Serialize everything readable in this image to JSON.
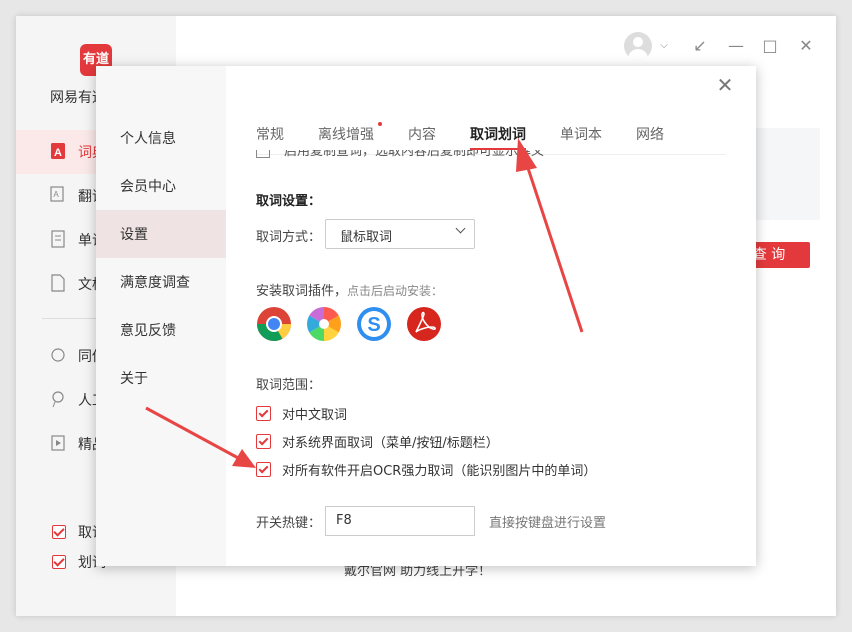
{
  "app": {
    "logo_text": "有道",
    "name": "网易有道",
    "sidebar": [
      {
        "label": "词典",
        "icon": "dictionary-icon"
      },
      {
        "label": "翻译",
        "icon": "translate-icon"
      },
      {
        "label": "单词本",
        "icon": "wordbook-icon"
      },
      {
        "label": "文档翻译",
        "icon": "document-icon"
      },
      {
        "label": "同传",
        "icon": "interpretation-icon"
      },
      {
        "label": "人工翻译",
        "icon": "human-translation-icon"
      },
      {
        "label": "精品课",
        "icon": "course-icon"
      }
    ],
    "bottom_checks": [
      {
        "label": "取词",
        "checked": true
      },
      {
        "label": "划词",
        "checked": true
      }
    ],
    "query_button": "查 询",
    "bottom_text": "戴尔官网 助力线上开学！"
  },
  "dialog": {
    "nav": [
      "个人信息",
      "会员中心",
      "设置",
      "满意度调查",
      "意见反馈",
      "关于"
    ],
    "active_nav": "设置",
    "tabs": [
      "常规",
      "离线增强",
      "内容",
      "取词划词",
      "单词本",
      "网络"
    ],
    "active_tab": "取词划词",
    "cut_option": "启用复制查词，选取内容后复制即可显示释义",
    "section_title": "取词设置：",
    "method_label": "取词方式：",
    "method_value": "鼠标取词",
    "plugin_label": "安装取词插件，",
    "plugin_hint": "点击后启动安装：",
    "plugins": [
      "chrome-icon",
      "color-pinwheel-icon",
      "sogou-browser-icon",
      "pdf-reader-icon"
    ],
    "range_label": "取词范围：",
    "range_options": [
      {
        "label": "对中文取词",
        "checked": true
      },
      {
        "label": "对系统界面取词（菜单/按钮/标题栏）",
        "checked": true
      },
      {
        "label": "对所有软件开启OCR强力取词（能识别图片中的单词）",
        "checked": true
      }
    ],
    "hotkey_label": "开关热键：",
    "hotkey_value": "F8",
    "hotkey_hint": "直接按键盘进行设置"
  },
  "colors": {
    "accent": "#e4393c",
    "annotation_arrow": "#e84545"
  }
}
